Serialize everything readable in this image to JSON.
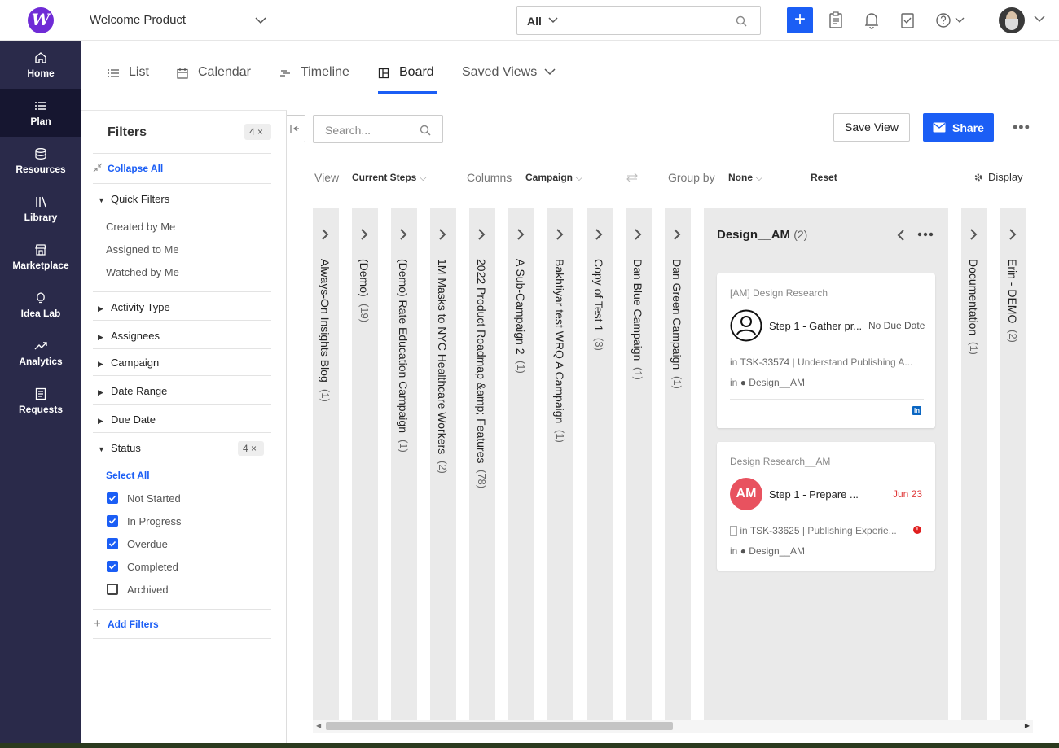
{
  "header": {
    "logo_letter": "W",
    "product": "Welcome Product",
    "search_scope": "All",
    "search_placeholder": "",
    "accent_color": "#1b5ef5"
  },
  "sidebar": {
    "items": [
      {
        "label": "Home",
        "icon": "home-icon"
      },
      {
        "label": "Plan",
        "icon": "list-icon",
        "active": true
      },
      {
        "label": "Resources",
        "icon": "database-icon"
      },
      {
        "label": "Library",
        "icon": "library-icon"
      },
      {
        "label": "Marketplace",
        "icon": "store-icon"
      },
      {
        "label": "Idea Lab",
        "icon": "lightbulb-icon"
      },
      {
        "label": "Analytics",
        "icon": "trend-icon"
      },
      {
        "label": "Requests",
        "icon": "form-icon"
      }
    ]
  },
  "tabs": [
    {
      "label": "List",
      "icon": "list-icon"
    },
    {
      "label": "Calendar",
      "icon": "calendar-icon"
    },
    {
      "label": "Timeline",
      "icon": "timeline-icon"
    },
    {
      "label": "Board",
      "icon": "board-icon",
      "active": true
    },
    {
      "label": "Saved Views",
      "icon": "chevron-down-icon"
    }
  ],
  "filters": {
    "title": "Filters",
    "count": "4 ×",
    "collapse_all": "Collapse All",
    "quick_filters": "Quick Filters",
    "quick_items": [
      "Created by Me",
      "Assigned to Me",
      "Watched by Me"
    ],
    "sections": [
      "Activity Type",
      "Assignees",
      "Campaign",
      "Date Range",
      "Due Date"
    ],
    "status": {
      "label": "Status",
      "count": "4 ×",
      "select_all": "Select All",
      "options": [
        {
          "label": "Not Started",
          "checked": true
        },
        {
          "label": "In Progress",
          "checked": true
        },
        {
          "label": "Overdue",
          "checked": true
        },
        {
          "label": "Completed",
          "checked": true
        },
        {
          "label": "Archived",
          "checked": false
        }
      ]
    },
    "add_filters": "Add Filters"
  },
  "toolbar": {
    "search_placeholder": "Search...",
    "save_view": "Save View",
    "share": "Share",
    "more": "•••",
    "view_label": "View",
    "view_value": "Current Steps",
    "columns_label": "Columns",
    "columns_value": "Campaign",
    "group_label": "Group by",
    "group_value": "None",
    "reset": "Reset",
    "display": "Display"
  },
  "board": {
    "collapsed_left": [
      {
        "name": "Always-On Insights Blog",
        "count": "(1)"
      },
      {
        "name": "(Demo)",
        "count": "(19)"
      },
      {
        "name": "(Demo) Rate Education Campaign",
        "count": "(1)"
      },
      {
        "name": "1M Masks to NYC Healthcare Workers",
        "count": "(2)"
      },
      {
        "name": "2022 Product Roadmap &amp; Features",
        "count": "(78)"
      },
      {
        "name": "A Sub-Campaign 2",
        "count": "(1)"
      },
      {
        "name": "Bakhtiyar test WRQ A Campaign",
        "count": "(1)"
      },
      {
        "name": "Copy of Test 1",
        "count": "(3)"
      },
      {
        "name": "Dan Blue Campaign",
        "count": "(1)"
      },
      {
        "name": "Dan Green Campaign",
        "count": "(1)"
      }
    ],
    "open_column": {
      "name": "Design__AM",
      "count": "(2)",
      "cards": [
        {
          "project": "[AM] Design Research",
          "step": "Step 1 - Gather pr...",
          "due": "No Due Date",
          "task_prefix": "in",
          "task": "TSK-33574",
          "task_name": "| Understand Publishing A...",
          "group_prefix": "in",
          "group": "Design__AM",
          "social": "in"
        },
        {
          "project": "Design Research__AM",
          "avatar": "AM",
          "step": "Step 1 - Prepare ...",
          "due": "Jun 23",
          "task_prefix": "in",
          "task": "TSK-33625",
          "task_name": "| Publishing Experie...",
          "group_prefix": "in",
          "group": "Design__AM"
        }
      ]
    },
    "collapsed_right": [
      {
        "name": "Documentation",
        "count": "(1)"
      },
      {
        "name": "Erin - DEMO",
        "count": "(2)"
      }
    ]
  }
}
